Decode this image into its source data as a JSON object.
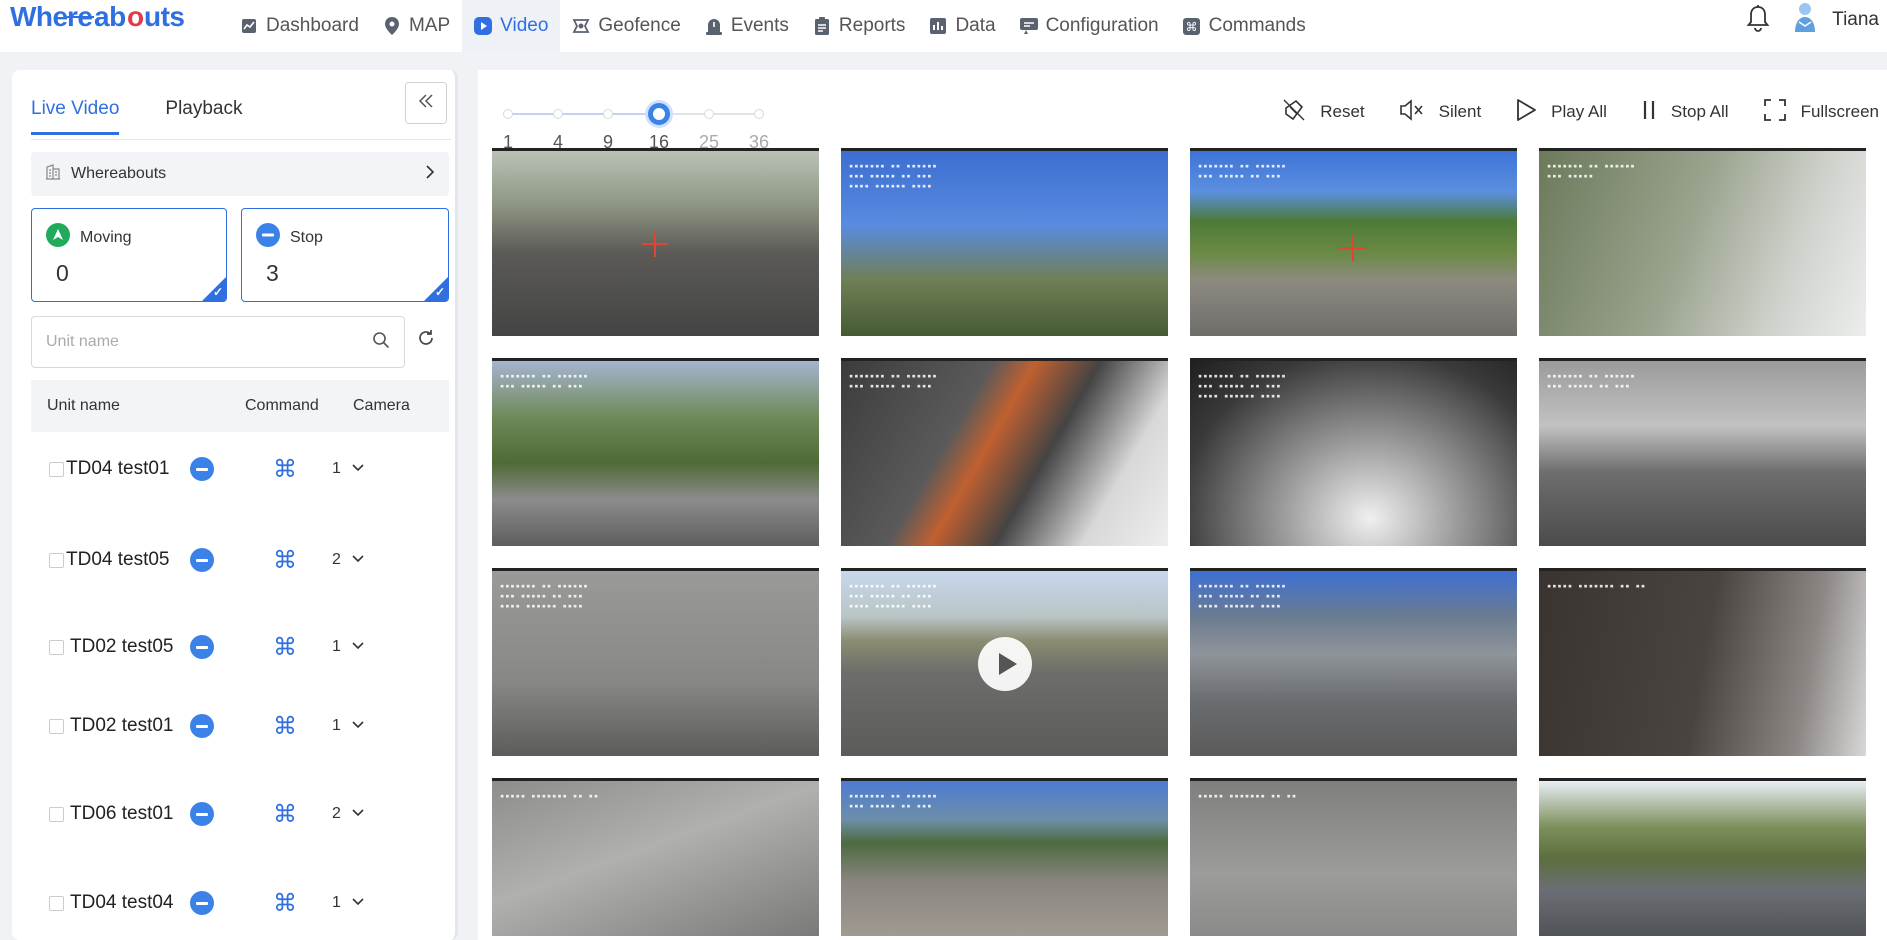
{
  "app": {
    "logo": "Whereabouts",
    "user_name": "Tiana"
  },
  "nav": [
    {
      "label": "Dashboard",
      "icon": "dashboard-icon",
      "active": false
    },
    {
      "label": "MAP",
      "icon": "map-pin-icon",
      "active": false
    },
    {
      "label": "Video",
      "icon": "play-circle-icon",
      "active": true
    },
    {
      "label": "Geofence",
      "icon": "geofence-icon",
      "active": false
    },
    {
      "label": "Events",
      "icon": "alarm-icon",
      "active": false
    },
    {
      "label": "Reports",
      "icon": "report-icon",
      "active": false
    },
    {
      "label": "Data",
      "icon": "bar-chart-icon",
      "active": false
    },
    {
      "label": "Configuration",
      "icon": "config-icon",
      "active": false
    },
    {
      "label": "Commands",
      "icon": "command-icon",
      "active": false
    }
  ],
  "left": {
    "tabs": [
      {
        "label": "Live Video",
        "active": true
      },
      {
        "label": "Playback",
        "active": false
      }
    ],
    "org": "Whereabouts",
    "moving": {
      "label": "Moving",
      "count": "0"
    },
    "stop": {
      "label": "Stop",
      "count": "3"
    },
    "search_placeholder": "Unit name",
    "columns": {
      "unit": "Unit name",
      "command": "Command",
      "camera": "Camera"
    },
    "units": [
      {
        "name": "TD04 test01",
        "camera": "1"
      },
      {
        "name": "TD04 test05",
        "camera": "2"
      },
      {
        "name": "TD02 test05",
        "camera": "1"
      },
      {
        "name": "TD02 test01",
        "camera": "1"
      },
      {
        "name": "TD06 test01",
        "camera": "2"
      },
      {
        "name": "TD04 test04",
        "camera": "1"
      }
    ]
  },
  "layout_options": {
    "values": [
      "1",
      "4",
      "9",
      "16",
      "25",
      "36"
    ],
    "selected": "16"
  },
  "toolbar": {
    "reset": "Reset",
    "silent": "Silent",
    "play_all": "Play All",
    "stop_all": "Stop All",
    "fullscreen": "Fullscreen"
  },
  "colors": {
    "accent": "#2f6fe0",
    "stop_status": "#3b82e8"
  }
}
